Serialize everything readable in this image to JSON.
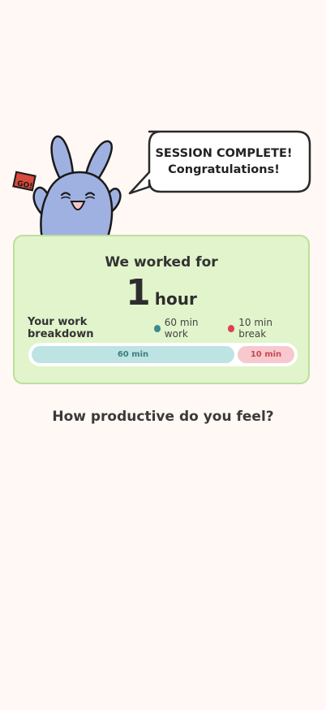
{
  "bubble": {
    "line1": "SESSION COMPLETE!",
    "line2": "Congratulations!"
  },
  "mascot": {
    "flag_text": "GO!"
  },
  "summary": {
    "title": "We worked for",
    "duration_value": "1",
    "duration_unit": "hour",
    "breakdown_label": "Your work breakdown",
    "legend": [
      {
        "label": "60 min work",
        "color": "#3b8a8f"
      },
      {
        "label": "10 min break",
        "color": "#d9434f"
      }
    ],
    "segments": [
      {
        "label": "60 min",
        "minutes": 60,
        "fill": "#bde3e2",
        "text_color": "#3f7d80"
      },
      {
        "label": "10 min",
        "minutes": 10,
        "fill": "#f7c9ce",
        "text_color": "#c84654"
      }
    ]
  },
  "question": "How productive do you feel?",
  "colors": {
    "background": "#fff8f4",
    "card": "#e1f4cb",
    "card_border": "#bcdf9d",
    "mascot_body": "#9fb1e1"
  }
}
